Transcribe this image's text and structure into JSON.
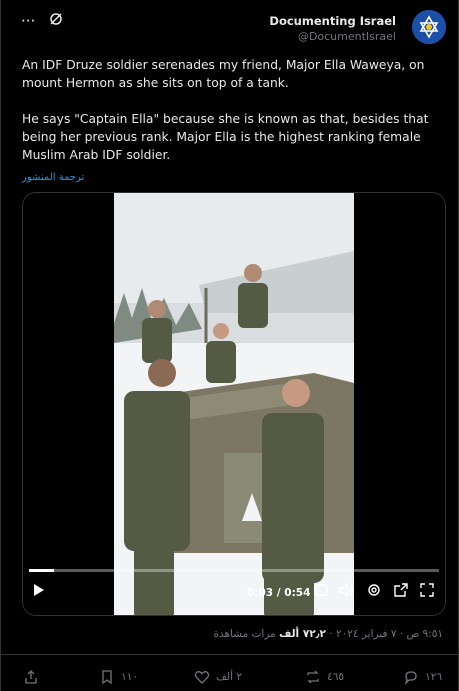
{
  "header": {
    "author_name": "Documenting Israel",
    "author_handle": "@DocumentIsrael",
    "more_icon": "more-icon",
    "grok_icon": "grok-icon"
  },
  "tweet": {
    "paragraph1": "An IDF Druze soldier serenades my friend, Major Ella Waweya, on mount Hermon as she sits on top of a tank.",
    "paragraph2": "He says \"Captain Ella\" because she is known as that, besides that being her previous rank. Major Ella is the highest ranking female Muslim Arab IDF soldier.",
    "translate_label": "ترجمة المنشور"
  },
  "video": {
    "current_time": "0:03 / 0:54",
    "progress": 0.06
  },
  "meta": {
    "timestamp": "٩:٥١ ص · ٧ فبراير ٢٠٢٤ · ",
    "views_count": "٧٢٫٢ ألف",
    "views_label": " مرات مشاهدة"
  },
  "actions": {
    "replies": "١٢٦",
    "reposts": "٤٦٥",
    "likes": "٢ ألف",
    "bookmarks": "١١٠"
  },
  "colors": {
    "accent": "#1d9bf0",
    "muted": "#71767b",
    "text": "#e7e9ea"
  }
}
